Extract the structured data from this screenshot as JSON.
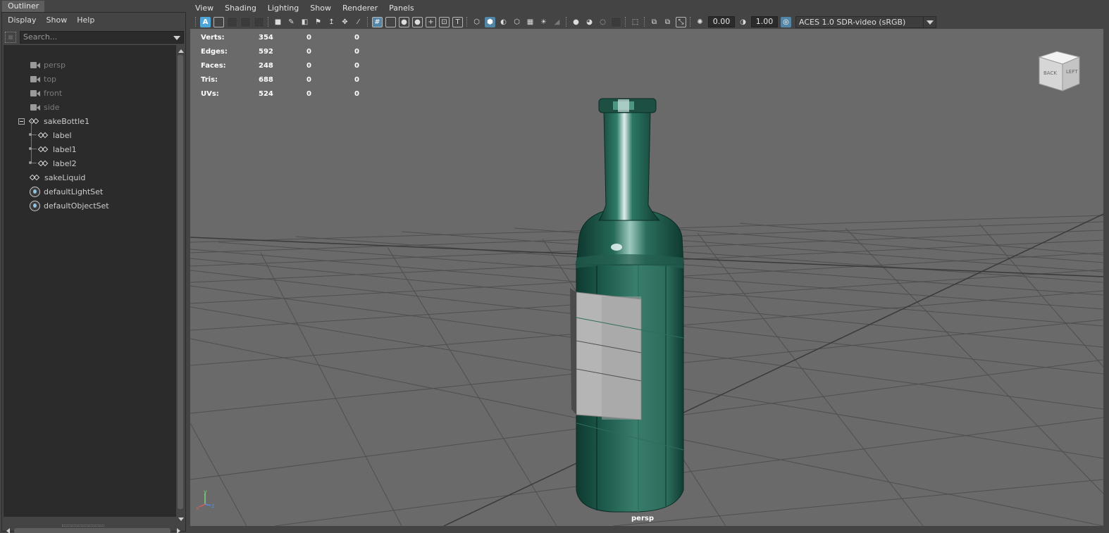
{
  "outliner": {
    "tab_label": "Outliner",
    "menu": [
      "Display",
      "Show",
      "Help"
    ],
    "search_placeholder": "Search...",
    "items": [
      {
        "label": "persp",
        "type": "camera"
      },
      {
        "label": "top",
        "type": "camera"
      },
      {
        "label": "front",
        "type": "camera"
      },
      {
        "label": "side",
        "type": "camera"
      },
      {
        "label": "sakeBottle1",
        "type": "group",
        "expanded": true
      },
      {
        "label": "label",
        "type": "group",
        "child": true
      },
      {
        "label": "label1",
        "type": "group",
        "child": true
      },
      {
        "label": "label2",
        "type": "group",
        "child": true
      },
      {
        "label": "sakeLiquid",
        "type": "group"
      },
      {
        "label": "defaultLightSet",
        "type": "set"
      },
      {
        "label": "defaultObjectSet",
        "type": "set"
      }
    ]
  },
  "viewport": {
    "menu": [
      "View",
      "Shading",
      "Lighting",
      "Show",
      "Renderer",
      "Panels"
    ],
    "exposure": "0.00",
    "gamma": "1.00",
    "color_space": "ACES 1.0 SDR-video (sRGB)",
    "camera_name": "persp",
    "view_cube": {
      "face_a": "BACK",
      "face_b": "LEFT"
    },
    "hud": [
      {
        "label": "Verts:",
        "v1": "354",
        "v2": "0",
        "v3": "0"
      },
      {
        "label": "Edges:",
        "v1": "592",
        "v2": "0",
        "v3": "0"
      },
      {
        "label": "Faces:",
        "v1": "248",
        "v2": "0",
        "v3": "0"
      },
      {
        "label": "Tris:",
        "v1": "688",
        "v2": "0",
        "v3": "0"
      },
      {
        "label": "UVs:",
        "v1": "524",
        "v2": "0",
        "v3": "0"
      }
    ],
    "axis_labels": {
      "x": "x",
      "y": "y",
      "z": "z"
    },
    "colors": {
      "bottle": "#1f5a4c",
      "label": "#a8a8a8",
      "grid": "#4e4e4e",
      "background": "#6a6a6a"
    }
  }
}
